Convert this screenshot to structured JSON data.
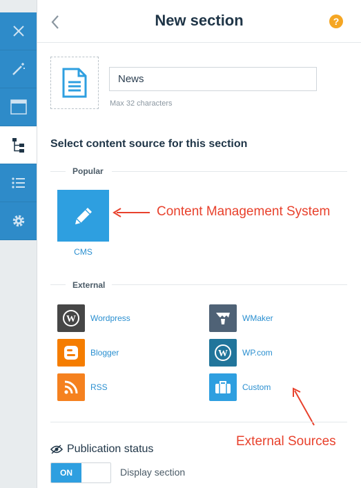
{
  "header": {
    "title": "New section",
    "help": "?"
  },
  "section": {
    "name_value": "News",
    "hint": "Max 32 characters"
  },
  "content_source": {
    "heading": "Select content source for this section",
    "popular_label": "Popular",
    "external_label": "External",
    "cms": {
      "label": "CMS",
      "color": "#2e9fe0"
    },
    "external": [
      {
        "label": "Wordpress",
        "color": "#464646",
        "icon": "wordpress-icon"
      },
      {
        "label": "WMaker",
        "color": "#4f6276",
        "icon": "wmaker-icon"
      },
      {
        "label": "Blogger",
        "color": "#f57d00",
        "icon": "blogger-icon"
      },
      {
        "label": "WP.com",
        "color": "#21759b",
        "icon": "wordpress-icon"
      },
      {
        "label": "RSS",
        "color": "#f5811f",
        "icon": "rss-icon"
      },
      {
        "label": "Custom",
        "color": "#2e9fe0",
        "icon": "briefcase-icon"
      }
    ]
  },
  "annotations": {
    "cms": "Content Management System",
    "external": "External Sources"
  },
  "publication": {
    "title": "Publication status",
    "toggle_on": "ON",
    "display_label": "Display section"
  },
  "colors": {
    "accent": "#2e9fe0",
    "rail": "#2e8bc9",
    "annotation": "#e8412c",
    "help": "#f5a623"
  }
}
